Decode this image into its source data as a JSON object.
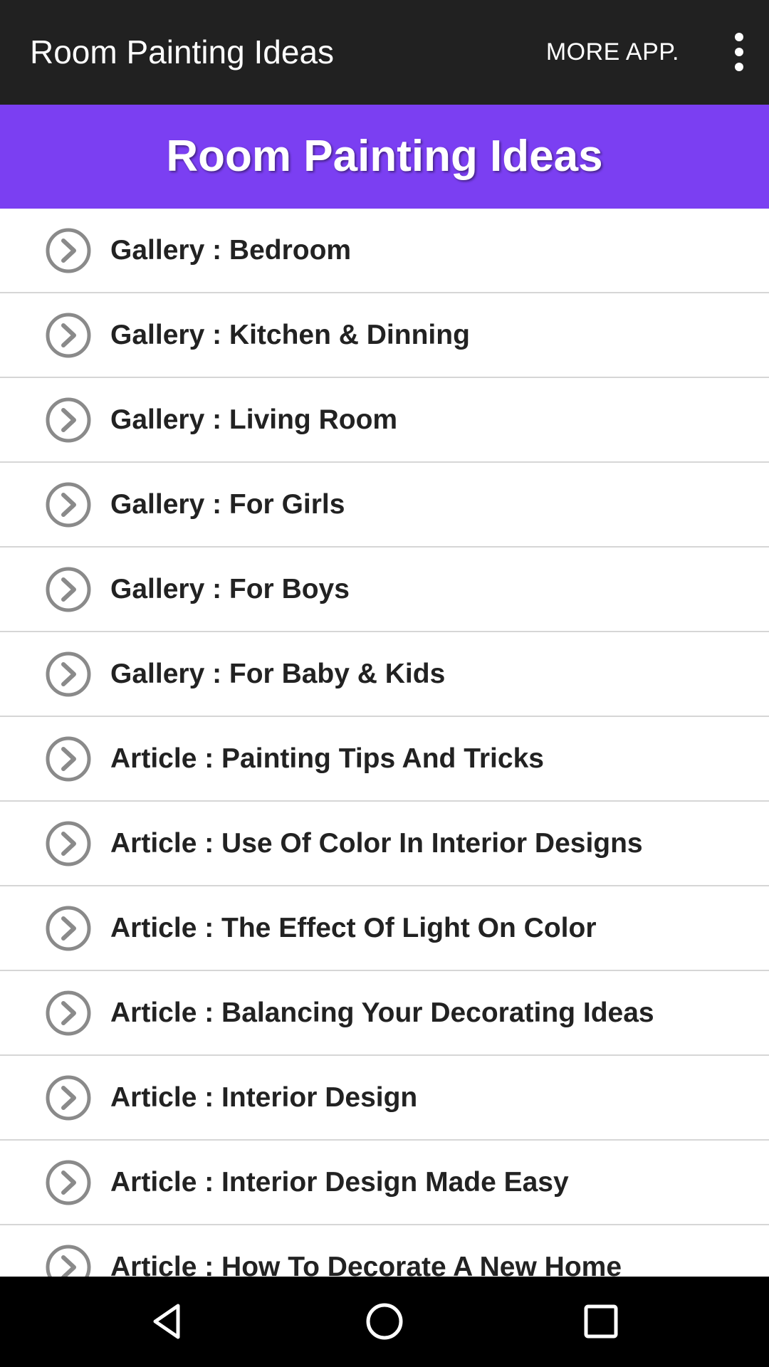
{
  "appbar": {
    "title": "Room Painting Ideas",
    "action_label": "MORE APP.",
    "overflow_icon": "more-vert-icon"
  },
  "banner": {
    "title": "Room Painting Ideas",
    "color": "#7b3ff2"
  },
  "list": {
    "item_icon": "chevron-circle-right-icon",
    "items": [
      {
        "label": "Gallery : Bedroom"
      },
      {
        "label": "Gallery : Kitchen & Dinning"
      },
      {
        "label": "Gallery : Living Room"
      },
      {
        "label": "Gallery : For Girls"
      },
      {
        "label": "Gallery : For Boys"
      },
      {
        "label": "Gallery : For Baby & Kids"
      },
      {
        "label": "Article : Painting Tips And Tricks"
      },
      {
        "label": "Article : Use Of Color In Interior Designs"
      },
      {
        "label": "Article : The Effect Of Light On Color"
      },
      {
        "label": "Article : Balancing Your Decorating Ideas"
      },
      {
        "label": "Article : Interior Design"
      },
      {
        "label": "Article : Interior Design Made Easy"
      },
      {
        "label": "Article : How To Decorate A New Home"
      }
    ]
  },
  "navbar": {
    "back_icon": "back-icon",
    "home_icon": "home-icon",
    "recents_icon": "recents-icon"
  }
}
